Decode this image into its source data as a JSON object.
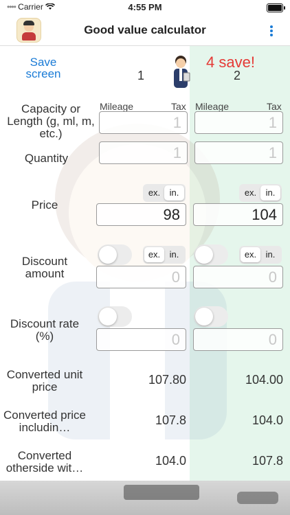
{
  "status_bar": {
    "carrier": "Carrier",
    "time": "4:55 PM"
  },
  "nav": {
    "title": "Good value calculator"
  },
  "header": {
    "save_screen": "Save\nscreen",
    "col1": "1",
    "col2": "2",
    "savings": "4 save!"
  },
  "rows": {
    "capacity": {
      "label": "Capacity or Length (g, ml, m, etc.)",
      "mileage": "Mileage",
      "tax": "Tax",
      "col1_value": "1",
      "col2_value": "1"
    },
    "quantity": {
      "label": "Quantity",
      "col1_value": "1",
      "col2_value": "1"
    },
    "price": {
      "label": "Price",
      "ex": "ex.",
      "in": "in.",
      "col1_value": "98",
      "col2_value": "104"
    },
    "discount_amount": {
      "label": "Discount amount",
      "ex": "ex.",
      "in": "in.",
      "col1_value": "0",
      "col2_value": "0"
    },
    "discount_rate": {
      "label": "Discount rate (%)",
      "col1_value": "0",
      "col2_value": "0"
    },
    "converted_unit_price": {
      "label": "Converted unit price",
      "col1_value": "107.80",
      "col2_value": "104.00"
    },
    "converted_price_including": {
      "label": "Converted price includin…",
      "col1_value": "107.8",
      "col2_value": "104.0"
    },
    "converted_otherside": {
      "label": "Converted otherside wit…",
      "col1_value": "104.0",
      "col2_value": "107.8"
    }
  },
  "icons": {
    "app": "shopkeeper-icon",
    "more": "more-vertical-icon",
    "wifi": "wifi-icon",
    "battery": "battery-icon"
  },
  "colors": {
    "accent": "#1a7bd6",
    "savings": "#e53935",
    "winner_column": "#e5f6ec"
  }
}
